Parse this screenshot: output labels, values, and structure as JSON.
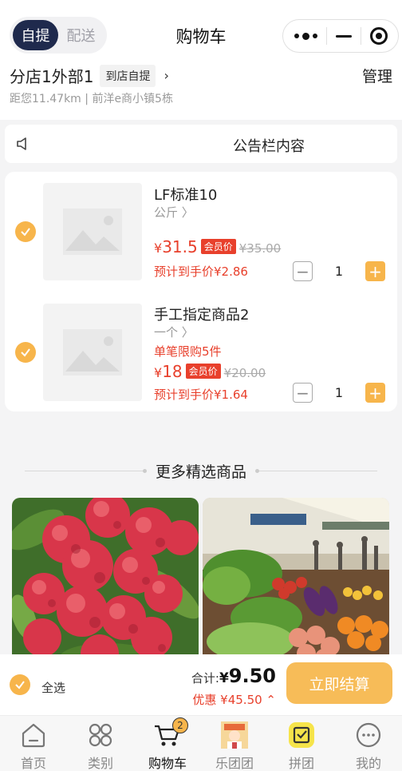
{
  "header": {
    "mode_options": [
      "自提",
      "配送"
    ],
    "title": "购物车",
    "store_name": "分店1外部1",
    "pickup_label": "到店自提",
    "chevron": "›",
    "manage_label": "管理",
    "distance_address": "距您11.47km | 前洋e商小镇5栋"
  },
  "notice": {
    "icon": "speaker-icon",
    "text": "公告栏内容"
  },
  "cart": {
    "items": [
      {
        "title": "LF标准10",
        "spec": "公斤 〉",
        "limit": "",
        "currency": "¥",
        "price": "31.5",
        "member_tag": "会员价",
        "original_price": "¥35.00",
        "estimate": "预计到手价¥2.86",
        "qty": "1",
        "minus": "−",
        "plus": "+"
      },
      {
        "title": "手工指定商品2",
        "spec": "一个 〉",
        "limit": "单笔限购5件",
        "currency": "¥",
        "price": "18",
        "member_tag": "会员价",
        "original_price": "¥20.00",
        "estimate": "预计到手价¥1.64",
        "qty": "1",
        "minus": "−",
        "plus": "+"
      }
    ]
  },
  "more": {
    "title": "更多精选商品"
  },
  "settle": {
    "select_all": "全选",
    "total_label": "合计:",
    "total_currency": "¥",
    "total_amount": "9.50",
    "discount": "优惠 ¥45.50 ⌃",
    "checkout_label": "立即结算"
  },
  "tabbar": {
    "items": [
      {
        "label": "首页",
        "icon": "home-icon"
      },
      {
        "label": "类别",
        "icon": "category-icon"
      },
      {
        "label": "购物车",
        "icon": "cart-icon",
        "badge": "2"
      },
      {
        "label": "乐团团",
        "icon": "group-avatar-icon"
      },
      {
        "label": "拼团",
        "icon": "group-buy-icon"
      },
      {
        "label": "我的",
        "icon": "profile-icon"
      }
    ]
  },
  "colors": {
    "accent": "#f7b54b",
    "price_red": "#e8402c",
    "dark_navy": "#1f2a4d"
  }
}
